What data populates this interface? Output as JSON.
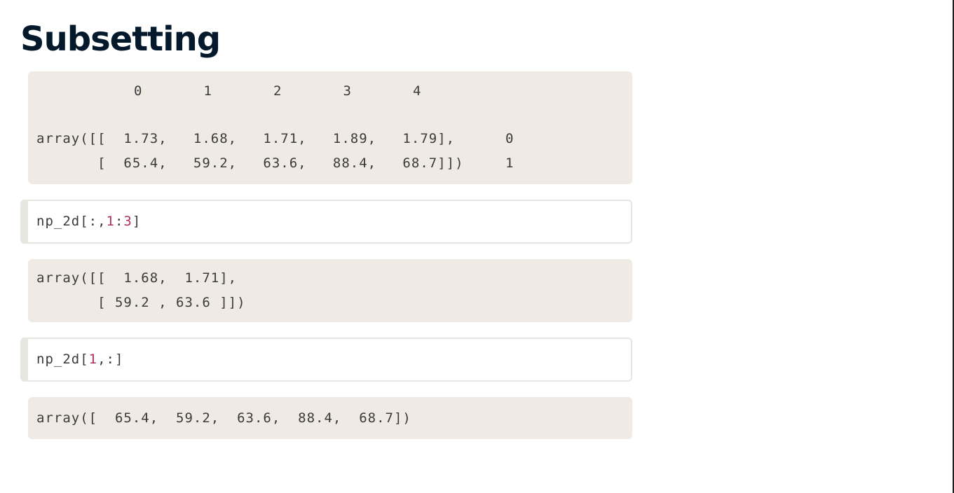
{
  "page": {
    "title": "Subsetting"
  },
  "block1": {
    "column_indices": "0       1       2       3       4",
    "row0_code": "array([[  1.73,   1.68,   1.71,   1.89,   1.79],",
    "row1_code": "       [  65.4,   59.2,   63.6,   88.4,   68.7]])",
    "row0_index": "0",
    "row1_index": "1"
  },
  "cell1": {
    "prefix": "np_2d[:,",
    "num_a": "1",
    "sep": ":",
    "num_b": "3",
    "suffix": "]"
  },
  "block2": {
    "line1": "array([[  1.68,  1.71],",
    "line2": "       [ 59.2 , 63.6 ]])"
  },
  "cell2": {
    "prefix": "np_2d[",
    "num": "1",
    "suffix": ",:]"
  },
  "block3": {
    "line1": "array([  65.4,  59.2,  63.6,  88.4,  68.7])"
  }
}
